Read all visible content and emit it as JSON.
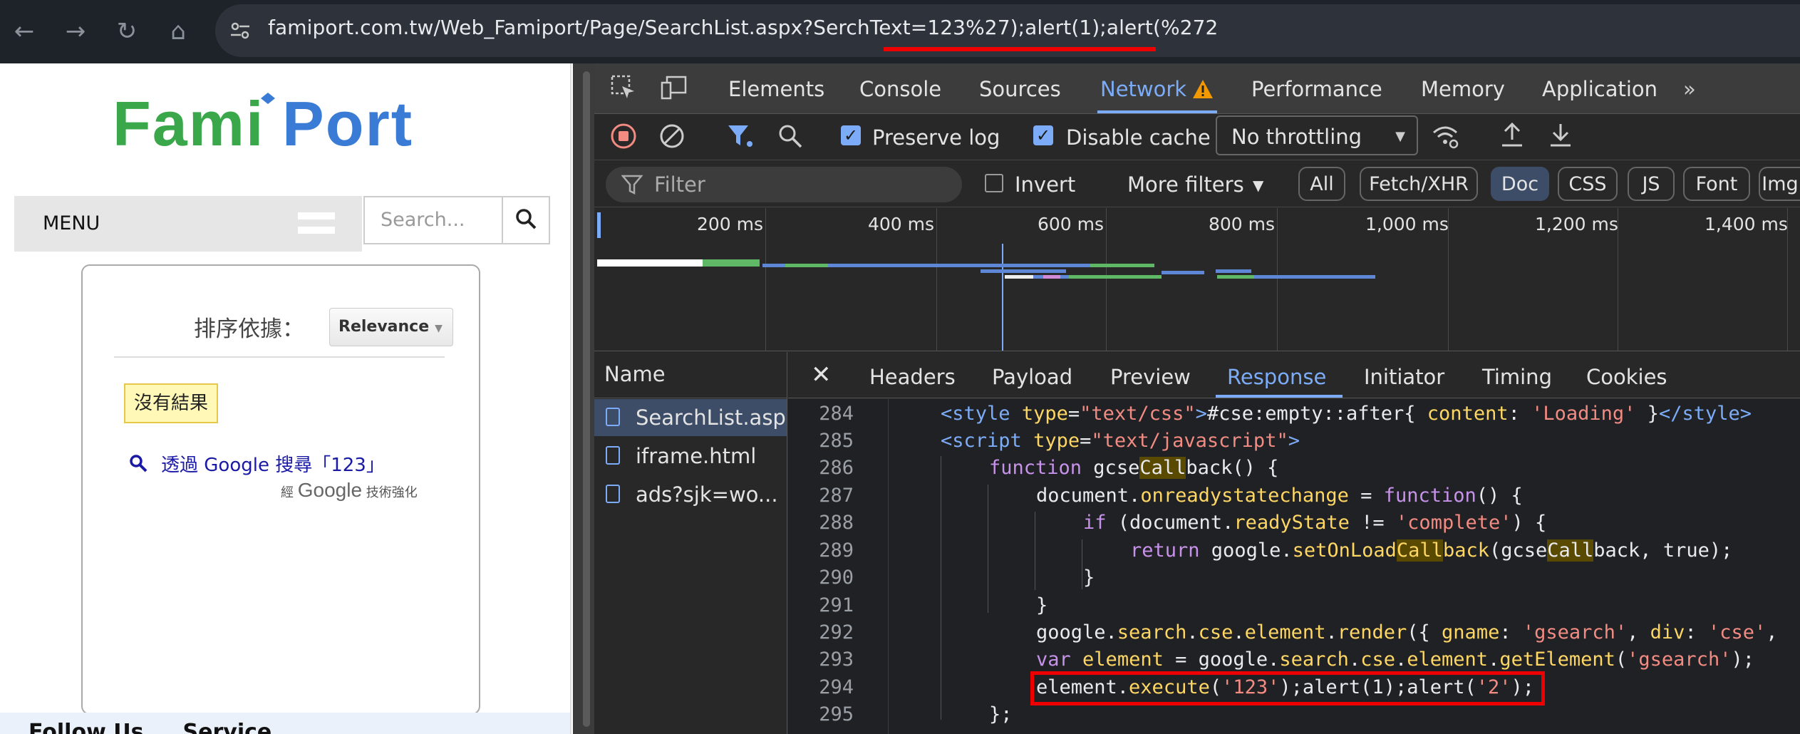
{
  "browser": {
    "url": "famiport.com.tw/Web_Famiport/Page/SearchList.aspx?SerchText=123%27);alert(1);alert(%272"
  },
  "page": {
    "logo_text": "FamiPort",
    "menu_label": "MENU",
    "search_placeholder": "Search...",
    "sort_label": "排序依據：",
    "sort_value": "Relevance",
    "no_result": "沒有結果",
    "google_search_link": "透過 Google 搜尋「123」",
    "powered_prefix": "經",
    "powered_brand": "Google",
    "powered_suffix": "技術強化",
    "bottom_text": "Follow Us ... Service"
  },
  "devtools": {
    "tabs": [
      "Elements",
      "Console",
      "Sources",
      "Network",
      "Performance",
      "Memory",
      "Application"
    ],
    "active_tab": "Network",
    "toolbar": {
      "preserve_log": "Preserve log",
      "disable_cache": "Disable cache",
      "throttling": "No throttling"
    },
    "filter": {
      "placeholder": "Filter",
      "invert": "Invert",
      "more_filters": "More filters",
      "chips": [
        "All",
        "Fetch/XHR",
        "Doc",
        "CSS",
        "JS",
        "Font",
        "Img"
      ],
      "active_chip": "Doc"
    },
    "timeline_ticks": [
      "200 ms",
      "400 ms",
      "600 ms",
      "800 ms",
      "1,000 ms",
      "1,200 ms",
      "1,400 ms"
    ],
    "name_header": "Name",
    "requests": [
      "SearchList.aspx",
      "iframe.html",
      "ads?sjk=wo..."
    ],
    "detail_tabs": [
      "Headers",
      "Payload",
      "Preview",
      "Response",
      "Initiator",
      "Timing",
      "Cookies"
    ],
    "active_detail_tab": "Response",
    "line_numbers": [
      "284",
      "285",
      "286",
      "287",
      "288",
      "289",
      "290",
      "291",
      "292",
      "293",
      "294",
      "295"
    ]
  },
  "colors": {
    "accent": "#7cacf8",
    "highlight_red": "#e00000",
    "logo_green": "#3aa84a",
    "logo_blue": "#3a7bd5"
  }
}
